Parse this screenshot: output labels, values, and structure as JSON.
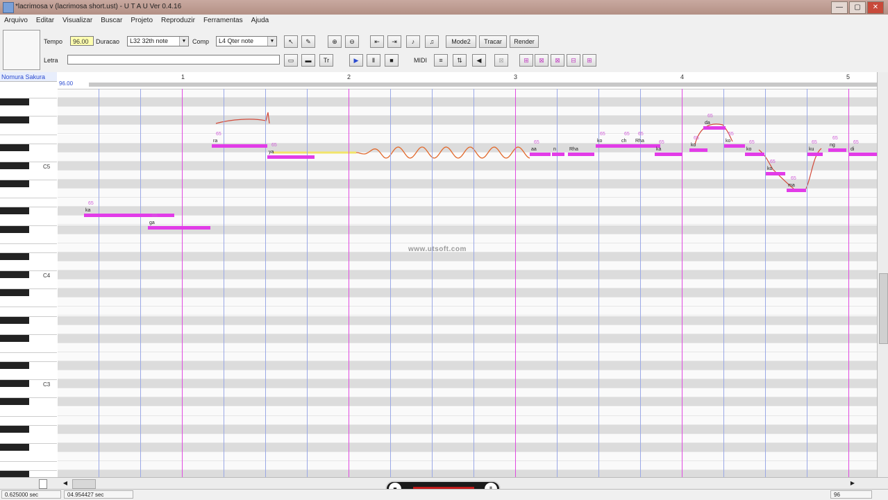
{
  "window": {
    "title": "*lacrimosa v (lacrimosa short.ust) - U T A U Ver 0.4.16",
    "buttons": [
      "—",
      "▢",
      "✕"
    ]
  },
  "menu": [
    "Arquivo",
    "Editar",
    "Visualizar",
    "Buscar",
    "Projeto",
    "Reproduzir",
    "Ferramentas",
    "Ajuda"
  ],
  "toolbar": {
    "tempo_label": "Tempo",
    "tempo_value": "96.00",
    "duracao_label": "Duracao",
    "duracao_value": "L32 32th note",
    "comp_label": "Comp",
    "comp_value": "L4  Qter note",
    "mode_label": "Mode2",
    "tracar_label": "Tracar",
    "render_label": "Render",
    "letra_label": "Letra",
    "letra_value": "",
    "midi_label": "MIDI"
  },
  "piano": {
    "singer": "Nomura Sakura",
    "octaves": [
      "C5",
      "C4",
      "C3"
    ]
  },
  "ruler": {
    "tempo": "96.00",
    "measures": [
      "1",
      "2",
      "3",
      "4",
      "5"
    ]
  },
  "notes": [
    {
      "lyric": "ka",
      "id": "65"
    },
    {
      "lyric": "ga",
      "id": "65"
    },
    {
      "lyric": "ra",
      "id": "65"
    },
    {
      "lyric": "ya",
      "id": "65"
    },
    {
      "lyric": "aa",
      "id": "65"
    },
    {
      "lyric": "n",
      "id": ""
    },
    {
      "lyric": "Rha",
      "id": ""
    },
    {
      "lyric": "ko",
      "id": "65"
    },
    {
      "lyric": "ch",
      "id": "65"
    },
    {
      "lyric": "Rha",
      "id": "65"
    },
    {
      "lyric": "ka",
      "id": "65"
    },
    {
      "lyric": "ko",
      "id": "65"
    },
    {
      "lyric": "da",
      "id": "65"
    },
    {
      "lyric": "ko",
      "id": "65"
    },
    {
      "lyric": "ko",
      "id": "65"
    },
    {
      "lyric": "ko",
      "id": "65"
    },
    {
      "lyric": "ma",
      "id": "65"
    },
    {
      "lyric": "ku",
      "id": "65"
    },
    {
      "lyric": "ng",
      "id": "65"
    },
    {
      "lyric": "di",
      "id": "65"
    }
  ],
  "watermark": "www.utsoft.com",
  "status": {
    "time1": "0.625000 sec",
    "time2": "04.954427 sec",
    "right": "96"
  }
}
